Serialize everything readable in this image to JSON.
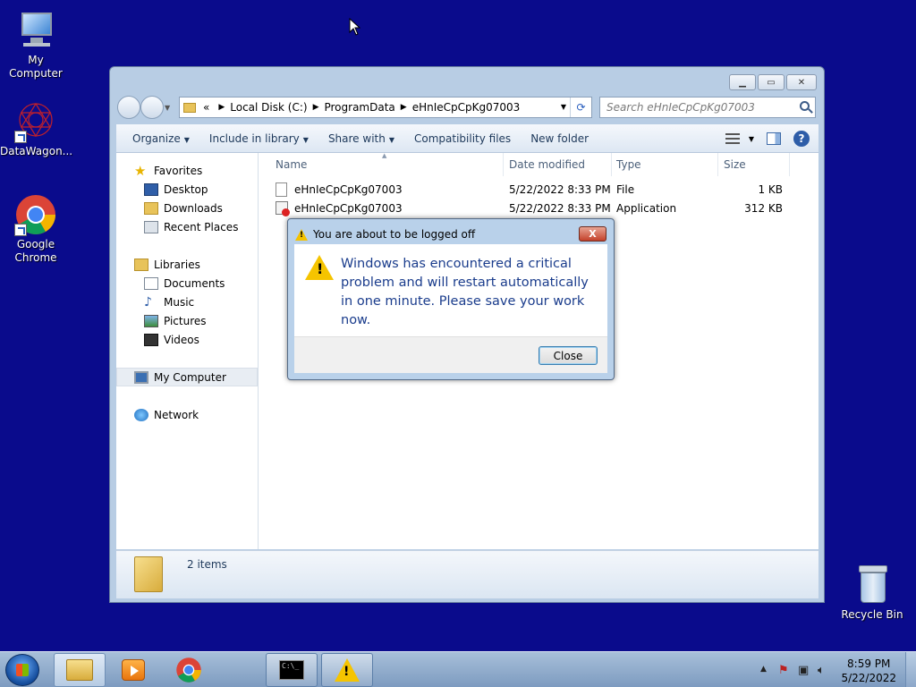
{
  "desktop": {
    "icons": [
      {
        "label": "My Computer"
      },
      {
        "label": "DataWagon..."
      },
      {
        "label": "Google Chrome"
      },
      {
        "label": "Recycle Bin"
      }
    ]
  },
  "explorer": {
    "address": {
      "overflow": "«",
      "crumbs": [
        "Local Disk (C:)",
        "ProgramData",
        "eHnIeCpCpKg07003"
      ]
    },
    "search": {
      "placeholder": "Search eHnIeCpCpKg07003"
    },
    "toolbar": {
      "organize": "Organize",
      "include_in_library": "Include in library",
      "share_with": "Share with",
      "compatibility_files": "Compatibility files",
      "new_folder": "New folder"
    },
    "nav": {
      "favorites": "Favorites",
      "desktop": "Desktop",
      "downloads": "Downloads",
      "recent_places": "Recent Places",
      "libraries": "Libraries",
      "documents": "Documents",
      "music": "Music",
      "pictures": "Pictures",
      "videos": "Videos",
      "my_computer": "My Computer",
      "network": "Network"
    },
    "columns": {
      "name": "Name",
      "date_modified": "Date modified",
      "type": "Type",
      "size": "Size"
    },
    "files": [
      {
        "name": "eHnIeCpCpKg07003",
        "date": "5/22/2022 8:33 PM",
        "type": "File",
        "size": "1 KB"
      },
      {
        "name": "eHnIeCpCpKg07003",
        "date": "5/22/2022 8:33 PM",
        "type": "Application",
        "size": "312 KB"
      }
    ],
    "status": {
      "count": "2 items"
    }
  },
  "dialog": {
    "title": "You are about to be logged off",
    "message": "Windows has encountered a critical problem and will restart automatically in one minute. Please save your work now.",
    "close_button": "Close",
    "title_close": "X"
  },
  "taskbar": {
    "time": "8:59 PM",
    "date": "5/22/2022"
  },
  "colors": {
    "desktop_bg": "#0a0b8c",
    "dialog_text": "#1a3c8c",
    "close_red": "#c4412a"
  }
}
